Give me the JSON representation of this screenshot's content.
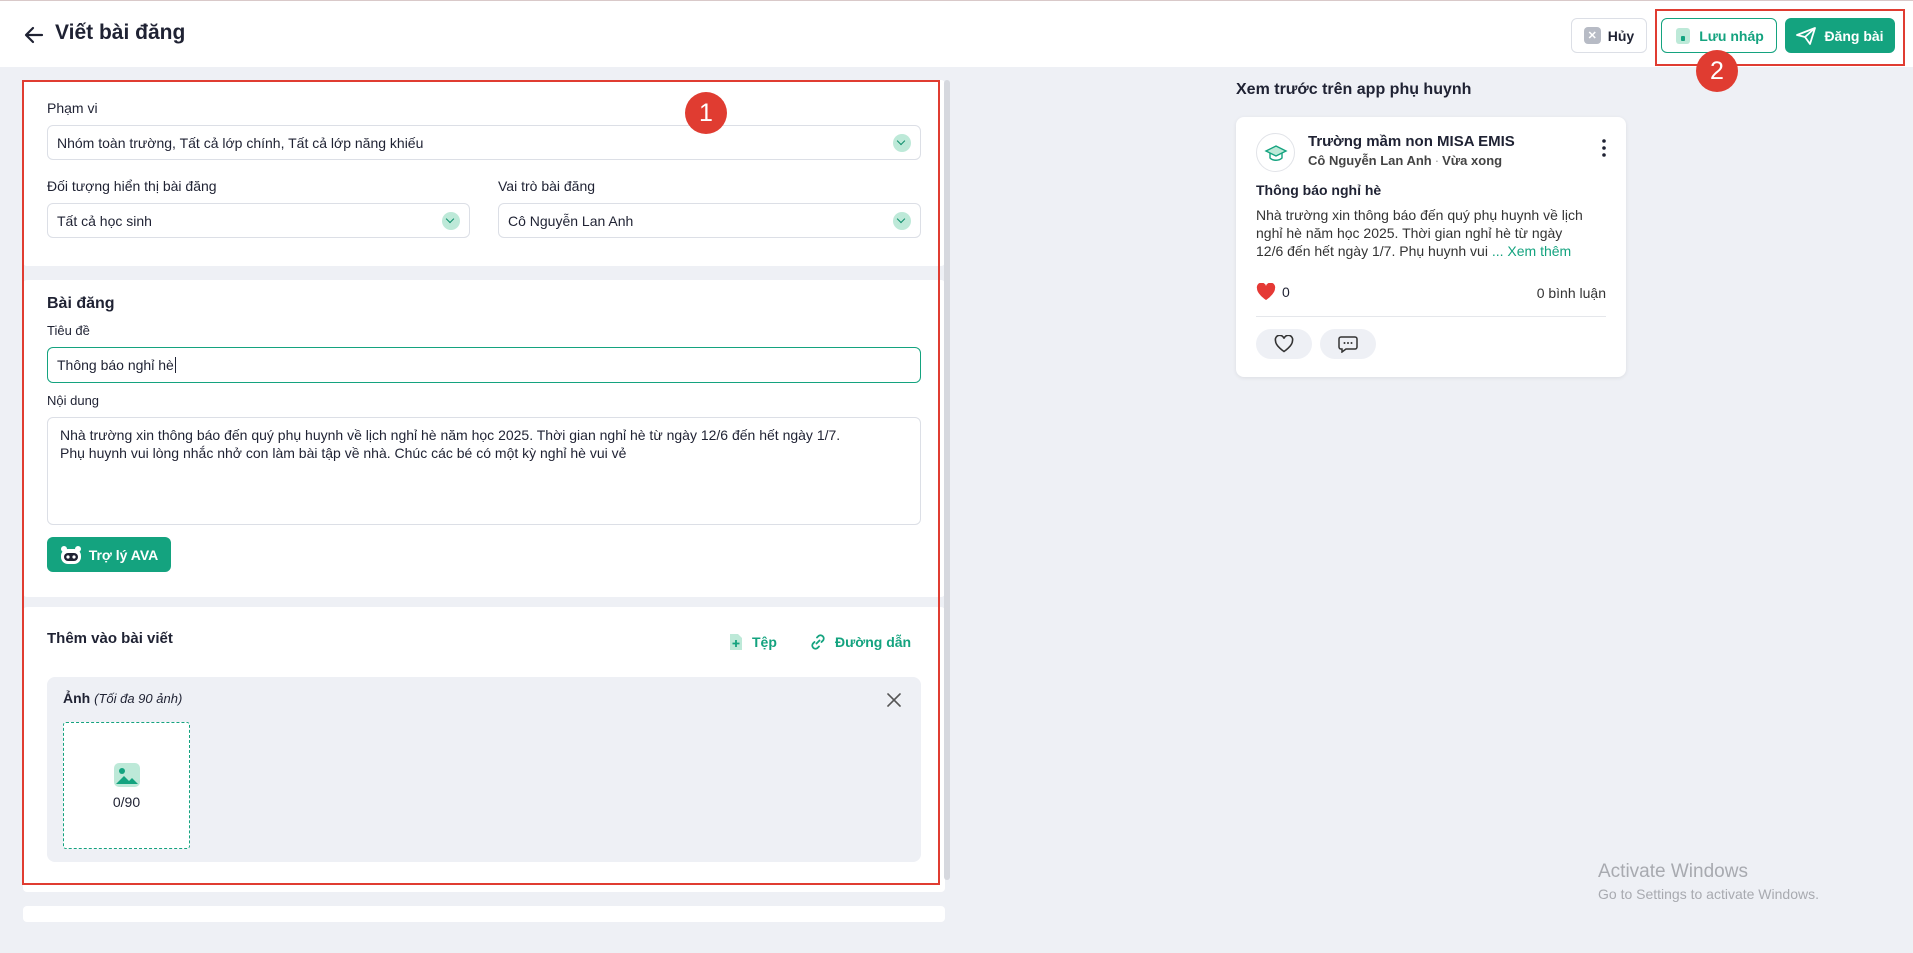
{
  "header": {
    "title": "Viết bài đăng",
    "cancel_label": "Hủy",
    "draft_label": "Lưu nháp",
    "post_label": "Đăng bài"
  },
  "annotations": {
    "one": "1",
    "two": "2"
  },
  "scope": {
    "label": "Phạm vi",
    "value": "Nhóm toàn trường, Tất cả lớp chính, Tất cả lớp năng khiếu"
  },
  "audience": {
    "label": "Đối tượng hiển thị bài đăng",
    "value": "Tất cả học sinh"
  },
  "role": {
    "label": "Vai trò bài đăng",
    "value": "Cô Nguyễn Lan Anh"
  },
  "post": {
    "section_title": "Bài đăng",
    "title_label": "Tiêu đề",
    "title_value": "Thông báo nghỉ hè",
    "content_label": "Nội dung",
    "content_line1": "Nhà trường xin thông báo đến quý phụ huynh về lịch nghỉ hè năm học 2025. Thời gian nghỉ hè từ ngày 12/6 đến hết ngày 1/7.",
    "content_line2": "Phụ huynh vui lòng nhắc nhở con làm bài tập về nhà. Chúc các bé có một kỳ nghỉ hè vui vẻ",
    "assistant_label": "Trợ lý AVA"
  },
  "attach": {
    "section_title": "Thêm vào bài viết",
    "file_label": "Tệp",
    "link_label": "Đường dẫn",
    "images_title": "Ảnh",
    "images_hint": "(Tối đa 90 ảnh)",
    "image_count": "0/90"
  },
  "preview": {
    "heading": "Xem trước trên app phụ huynh",
    "school": "Trường mầm non MISA EMIS",
    "author": "Cô Nguyễn Lan Anh",
    "time": "Vừa xong",
    "post_title": "Thông báo nghỉ hè",
    "body_line1": "Nhà trường xin thông báo đến quý phụ huynh về lịch",
    "body_line2": "nghỉ hè năm học 2025. Thời gian nghỉ hè từ ngày",
    "body_line3": "12/6 đến hết ngày 1/7. Phụ huynh vui",
    "see_more": "... Xem thêm",
    "likes": "0",
    "comments": "0 bình luận"
  },
  "watermark": {
    "line1": "Activate Windows",
    "line2": "Go to Settings to activate Windows."
  },
  "colors": {
    "accent": "#14a37f",
    "annotation": "#e03c31",
    "heart": "#e53935"
  },
  "icons": [
    "arrow-left-icon",
    "close-icon",
    "save-draft-icon",
    "send-icon",
    "chevron-down-icon",
    "robot-icon",
    "file-plus-icon",
    "link-icon",
    "image-icon",
    "school-logo-icon",
    "kebab-icon",
    "heart-icon",
    "comment-icon"
  ]
}
